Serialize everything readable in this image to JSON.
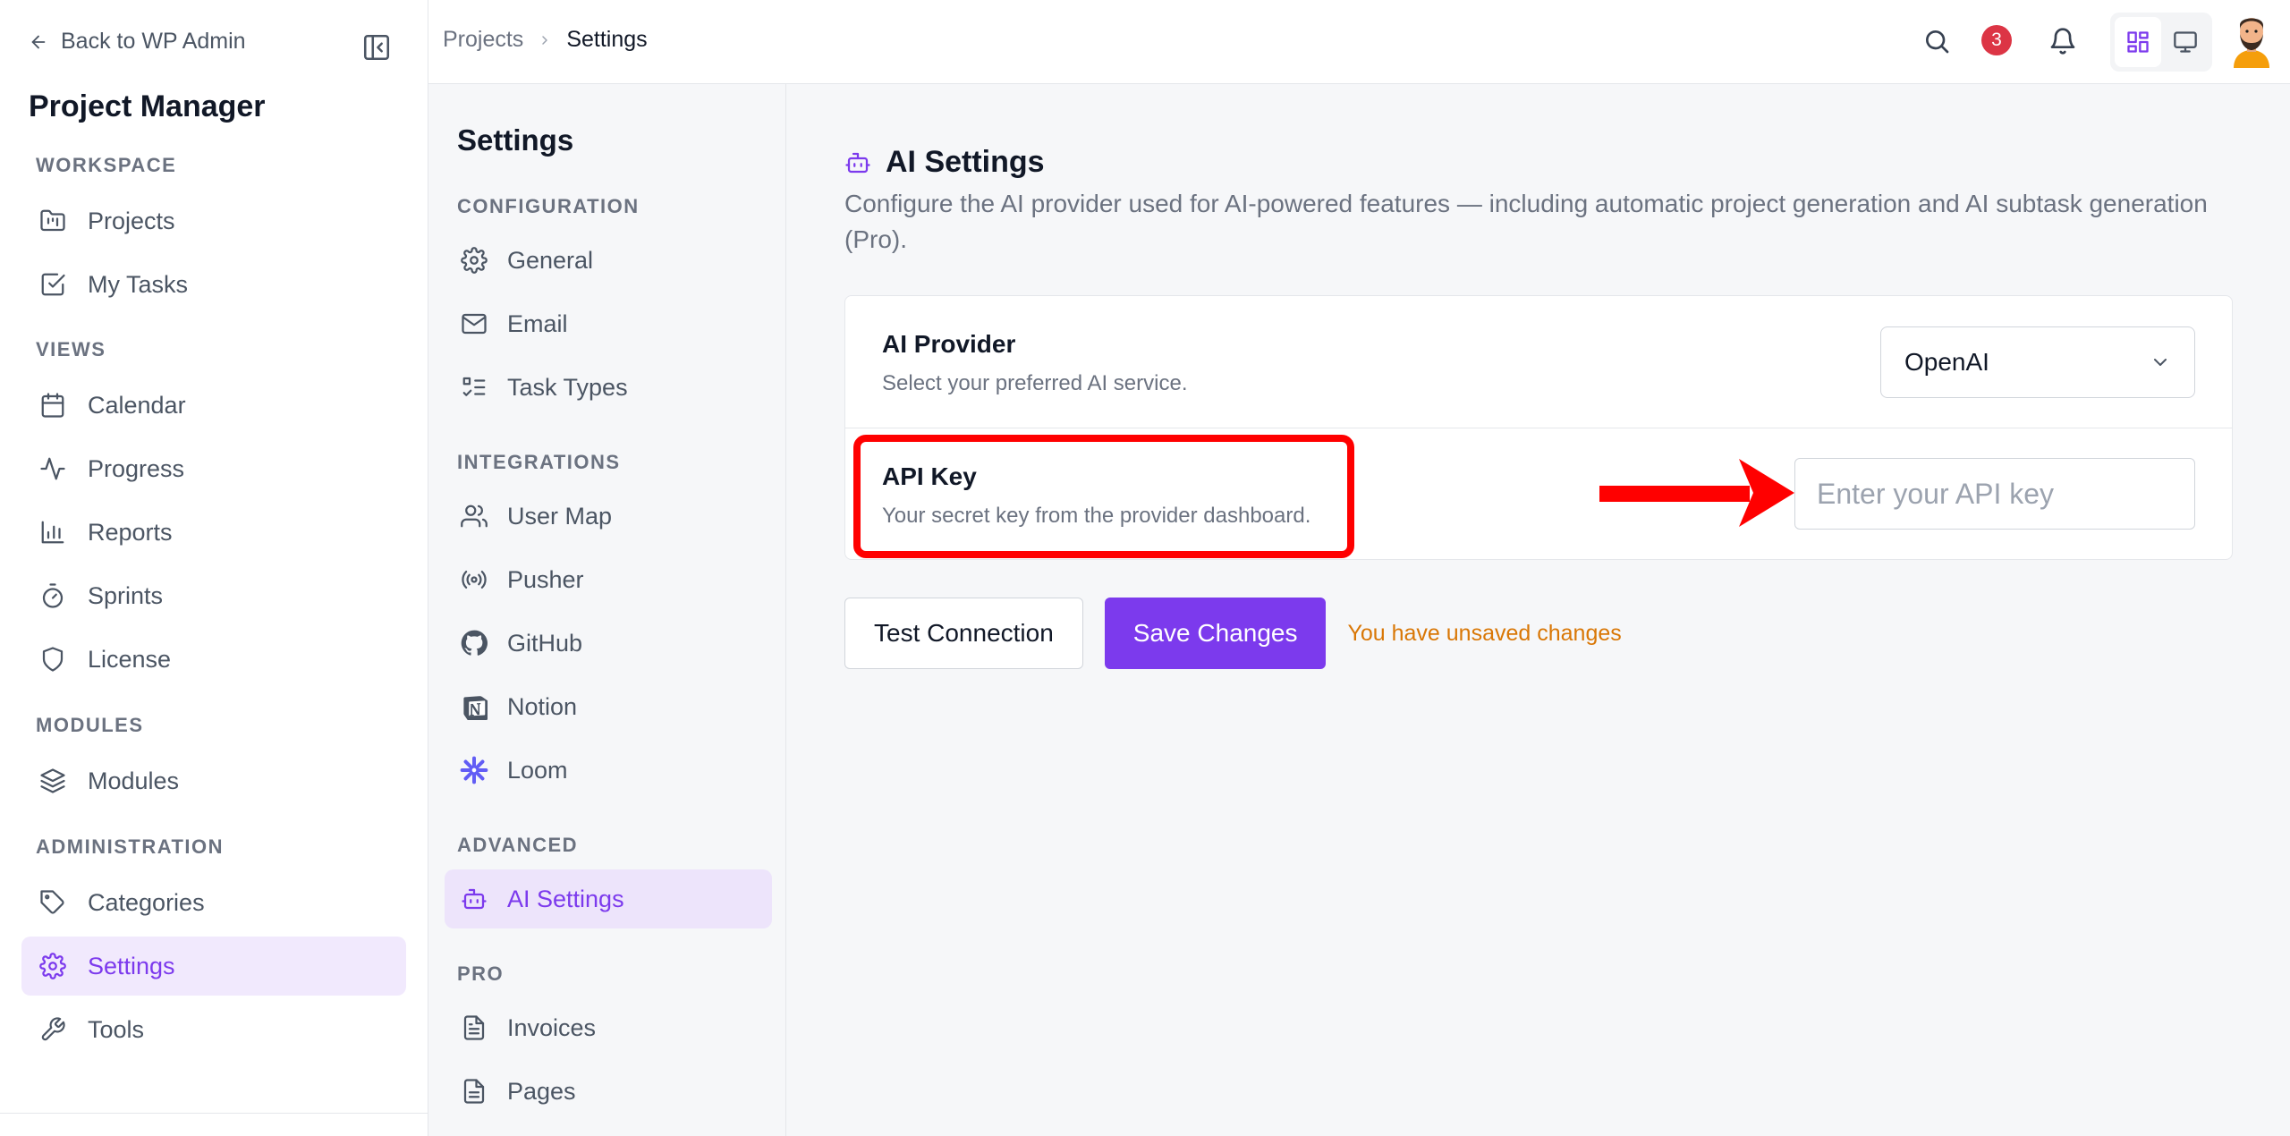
{
  "sidebar": {
    "back_label": "Back to WP Admin",
    "app_title": "Project Manager",
    "sections": {
      "workspace": "WORKSPACE",
      "views": "VIEWS",
      "modules": "MODULES",
      "administration": "ADMINISTRATION"
    },
    "items": {
      "projects": "Projects",
      "my_tasks": "My Tasks",
      "calendar": "Calendar",
      "progress": "Progress",
      "reports": "Reports",
      "sprints": "Sprints",
      "license": "License",
      "modules": "Modules",
      "categories": "Categories",
      "settings": "Settings",
      "tools": "Tools"
    },
    "active_item": "settings"
  },
  "topbar": {
    "breadcrumb": [
      "Projects",
      "Settings"
    ],
    "notification_count": "3"
  },
  "subnav": {
    "title": "Settings",
    "sections": {
      "configuration": "CONFIGURATION",
      "integrations": "INTEGRATIONS",
      "advanced": "ADVANCED",
      "pro": "PRO"
    },
    "items": {
      "general": "General",
      "email": "Email",
      "task_types": "Task Types",
      "user_map": "User Map",
      "pusher": "Pusher",
      "github": "GitHub",
      "notion": "Notion",
      "loom": "Loom",
      "ai_settings": "AI Settings",
      "invoices": "Invoices",
      "pages": "Pages"
    },
    "active_item": "ai_settings"
  },
  "main": {
    "title": "AI Settings",
    "description": "Configure the AI provider used for AI-powered features — including automatic project generation and AI subtask generation (Pro).",
    "provider": {
      "label": "AI Provider",
      "help": "Select your preferred AI service.",
      "value": "OpenAI"
    },
    "api_key": {
      "label": "API Key",
      "help": "Your secret key from the provider dashboard.",
      "value": "",
      "placeholder": "Enter your API key"
    },
    "test_button": "Test Connection",
    "save_button": "Save Changes",
    "unsaved_notice": "You have unsaved changes"
  },
  "colors": {
    "accent": "#7c3aed",
    "accent_bg": "#f1e9fd",
    "warning": "#d97706",
    "badge": "#dc3545",
    "annotation": "#ff0000"
  }
}
